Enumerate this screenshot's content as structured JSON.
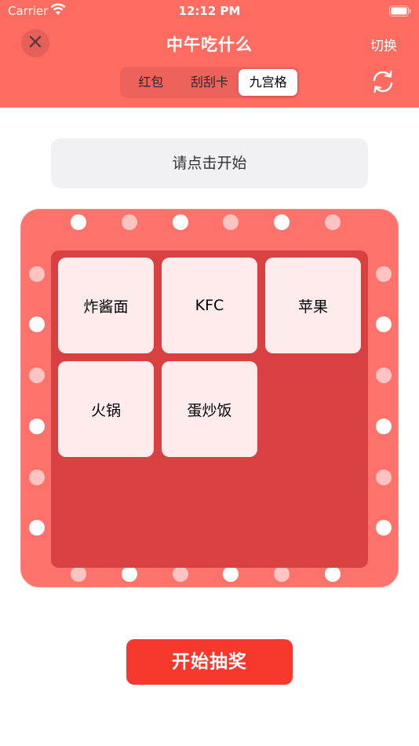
{
  "status_bar": {
    "carrier": "Carrier",
    "time": "12:12 PM"
  },
  "nav": {
    "title": "中午吃什么",
    "switch_label": "切换"
  },
  "tabs": [
    {
      "label": "红包",
      "active": false
    },
    {
      "label": "刮刮卡",
      "active": false
    },
    {
      "label": "九宫格",
      "active": true
    }
  ],
  "prompt": "请点击开始",
  "grid": {
    "cells": [
      "炸酱面",
      "KFC",
      "苹果",
      "火锅",
      "蛋炒饭"
    ]
  },
  "start_button": "开始抽奖",
  "colors": {
    "header": "#fe6b61",
    "board": "#fd726a",
    "board_inner": "#d94042",
    "cell": "#feecec",
    "button": "#f6392c"
  },
  "icons": {
    "close": "close-icon",
    "refresh": "refresh-icon",
    "wifi": "wifi-icon",
    "battery": "battery-icon"
  }
}
